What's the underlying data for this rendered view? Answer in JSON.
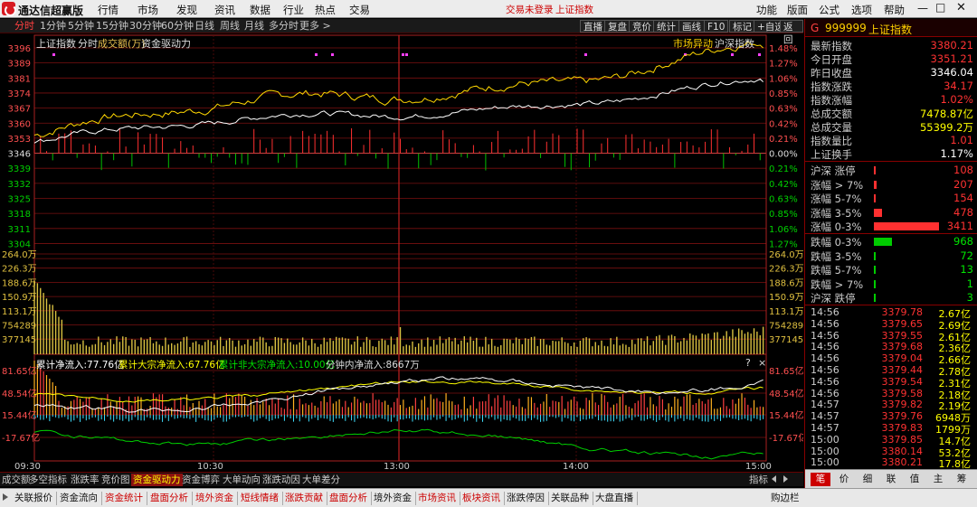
{
  "app": {
    "name": "通达信超赢版",
    "menu": [
      "行情",
      "市场",
      "发现",
      "资讯",
      "数据",
      "行业",
      "热点",
      "交易"
    ],
    "login_status": "交易未登录",
    "index_name": "上证指数",
    "right_menu": [
      "功能",
      "版面",
      "公式",
      "选项",
      "帮助"
    ]
  },
  "toolbar": {
    "periods": [
      "分时",
      "1分钟",
      "5分钟",
      "15分钟",
      "30分钟",
      "60分钟",
      "日线",
      "周线",
      "月线",
      "多分时",
      "更多 >"
    ],
    "buttons": [
      "直播",
      "复盘",
      "竞价",
      "统计",
      "画线",
      "F10",
      "标记",
      "+自选",
      "返回"
    ]
  },
  "chart_header": {
    "name": "上证指数",
    "tag1": "分时",
    "tag2": "成交额(万)",
    "tag3": "资金驱动力",
    "right1": "市场异动",
    "right2": "沪深指数"
  },
  "flow_header": {
    "item1": "累计净流入:77.76亿",
    "item2": "累计大宗净流入:67.76亿",
    "item3": "累计非大宗净流入:10.00亿",
    "item4": "分钟内净流入:8667万",
    "help": "?",
    "close": "×"
  },
  "axes": {
    "price_left": [
      "3396",
      "3389",
      "3381",
      "3374",
      "3367",
      "3360",
      "3353",
      "3346",
      "3339",
      "3332",
      "3325",
      "3318",
      "3311",
      "3304"
    ],
    "pct_right": [
      "1.48%",
      "1.27%",
      "1.06%",
      "0.85%",
      "0.63%",
      "0.42%",
      "0.21%",
      "0.00%",
      "0.21%",
      "0.42%",
      "0.63%",
      "0.85%",
      "1.06%",
      "1.27%"
    ],
    "vol_labels": [
      "264.0万",
      "226.3万",
      "188.6万",
      "150.9万",
      "113.1万",
      "754289",
      "377145"
    ],
    "flow_labels": [
      "81.65亿",
      "48.54亿",
      "15.44亿",
      "-17.67亿"
    ],
    "time_labels": [
      "09:30",
      "10:30",
      "13:00",
      "14:00",
      "15:00"
    ]
  },
  "chart_data": {
    "type": "line",
    "price_range": [
      3304,
      3396
    ],
    "prev_close": 3346.04,
    "white_line_start": 3352,
    "white_line_end": 3380,
    "yellow_line_start": 3355,
    "yellow_line_end": 3396
  },
  "tabs1": [
    "成交额",
    "多空指标",
    "涨跌率",
    "竞价图",
    "资金驱动力",
    "资金博弈",
    "大单动向",
    "涨跌动因",
    "大单差分"
  ],
  "tabs1_active": "资金驱动力",
  "tabs1_right": "指标",
  "tabs2": [
    "关联报价",
    "资金流向",
    "资金统计",
    "盘面分析",
    "境外资金",
    "短线情绪",
    "涨跌贡献",
    "盘面分析",
    "境外资金",
    "市场资讯",
    "板块资讯",
    "涨跌停因",
    "关联品种",
    "大盘直播"
  ],
  "tabs2_right": "购边栏",
  "panel": {
    "prefix": "G",
    "code": "999999",
    "name": "上证指数",
    "stats": [
      {
        "label": "最新指数",
        "value": "3380.21",
        "color": "red"
      },
      {
        "label": "今日开盘",
        "value": "3351.21",
        "color": "red"
      },
      {
        "label": "昨日收盘",
        "value": "3346.04",
        "color": "wht"
      },
      {
        "label": "指数涨跌",
        "value": "34.17",
        "color": "red"
      },
      {
        "label": "指数涨幅",
        "value": "1.02%",
        "color": "red"
      },
      {
        "label": "总成交额",
        "value": "7478.87亿",
        "color": "yel"
      },
      {
        "label": "总成交量",
        "value": "55399.2万",
        "color": "yel"
      },
      {
        "label": "指数量比",
        "value": "1.01",
        "color": "red"
      },
      {
        "label": "上证换手",
        "value": "1.17%",
        "color": "wht"
      }
    ],
    "breadth_up": [
      {
        "label": "沪深 涨停",
        "value": "108",
        "bar": 0.02
      },
      {
        "label": "涨幅 > 7%",
        "value": "207",
        "bar": 0.04
      },
      {
        "label": "涨幅 5-7%",
        "value": "154",
        "bar": 0.03
      },
      {
        "label": "涨幅 3-5%",
        "value": "478",
        "bar": 0.13
      },
      {
        "label": "涨幅 0-3%",
        "value": "3411",
        "bar": 1.0
      }
    ],
    "breadth_down": [
      {
        "label": "跌幅 0-3%",
        "value": "968",
        "bar": 0.28
      },
      {
        "label": "跌幅 3-5%",
        "value": "72",
        "bar": 0.01
      },
      {
        "label": "跌幅 5-7%",
        "value": "13",
        "bar": 0.01
      },
      {
        "label": "跌幅 > 7%",
        "value": "1",
        "bar": 0.01
      },
      {
        "label": "沪深 跌停",
        "value": "3",
        "bar": 0.01
      }
    ],
    "ticks": [
      {
        "time": "14:56",
        "price": "3379.78",
        "vol": "2.67亿",
        "dir": "up"
      },
      {
        "time": "14:56",
        "price": "3379.65",
        "vol": "2.69亿",
        "dir": "up"
      },
      {
        "time": "14:56",
        "price": "3379.55",
        "vol": "2.61亿",
        "dir": "up"
      },
      {
        "time": "14:56",
        "price": "3379.68",
        "vol": "2.36亿",
        "dir": "up"
      },
      {
        "time": "14:56",
        "price": "3379.04",
        "vol": "2.66亿",
        "dir": "up"
      },
      {
        "time": "14:56",
        "price": "3379.44",
        "vol": "2.78亿",
        "dir": "up"
      },
      {
        "time": "14:56",
        "price": "3379.54",
        "vol": "2.31亿",
        "dir": "up"
      },
      {
        "time": "14:56",
        "price": "3379.58",
        "vol": "2.18亿",
        "dir": "up"
      },
      {
        "time": "14:57",
        "price": "3379.82",
        "vol": "2.19亿",
        "dir": "up"
      },
      {
        "time": "14:57",
        "price": "3379.76",
        "vol": "6948万",
        "dir": "up"
      },
      {
        "time": "14:57",
        "price": "3379.83",
        "vol": "1799万",
        "dir": "up"
      },
      {
        "time": "15:00",
        "price": "3379.85",
        "vol": "14.7亿",
        "dir": "up"
      },
      {
        "time": "15:00",
        "price": "3380.14",
        "vol": "53.2亿",
        "dir": "up"
      },
      {
        "time": "15:00",
        "price": "3380.21",
        "vol": "17.8亿",
        "dir": "up"
      }
    ],
    "bottom_tabs": [
      "笔",
      "价",
      "细",
      "联",
      "值",
      "主",
      "筹"
    ],
    "bottom_active": "笔"
  }
}
